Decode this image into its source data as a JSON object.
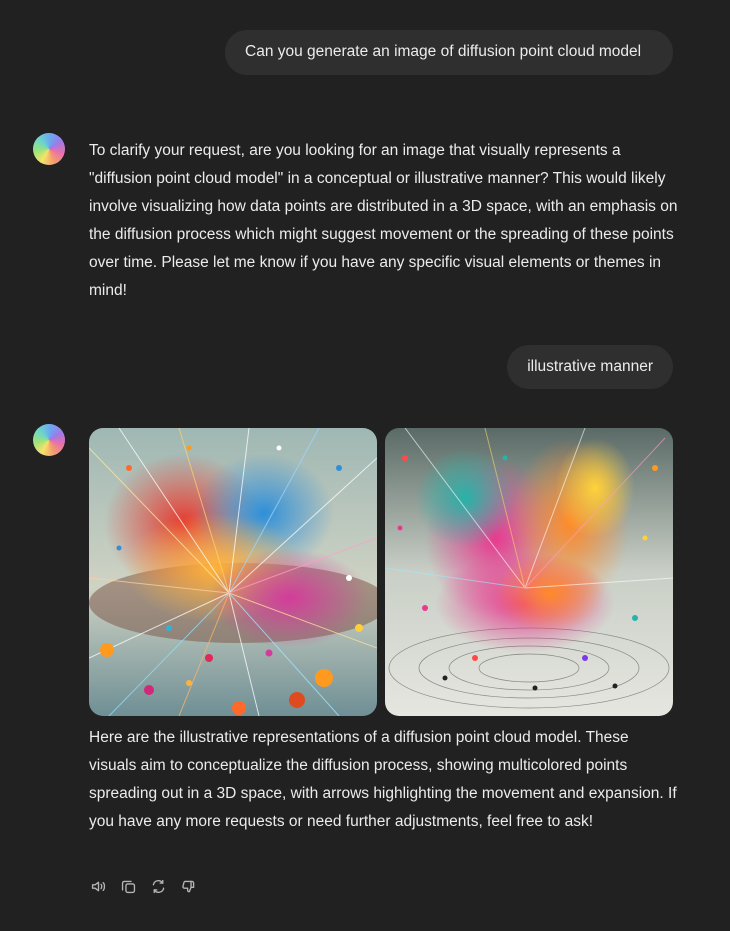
{
  "conversation": {
    "user_message_1": "Can you generate an image of diffusion point cloud model",
    "assistant_message_1": "To clarify your request, are you looking for an image that visually represents a \"diffusion point cloud model\" in a conceptual or illustrative manner? This would likely involve visualizing how data points are distributed in a 3D space, with an emphasis on the diffusion process which might suggest movement or the spreading of these points over time. Please let me know if you have any specific visual elements or themes in mind!",
    "user_message_2": "illustrative manner",
    "assistant_message_2": "Here are the illustrative representations of a diffusion point cloud model. These visuals aim to conceptualize the diffusion process, showing multicolored points spreading out in a 3D space, with arrows highlighting the movement and expansion. If you have any more requests or need further adjustments, feel free to ask!"
  },
  "actions": {
    "icons": [
      "read-aloud-icon",
      "copy-icon",
      "regenerate-icon",
      "thumbs-down-icon"
    ]
  },
  "colors": {
    "background": "#212121",
    "bubble": "#2f2f2f",
    "text": "#ececec",
    "icon": "#b4b4b4"
  }
}
